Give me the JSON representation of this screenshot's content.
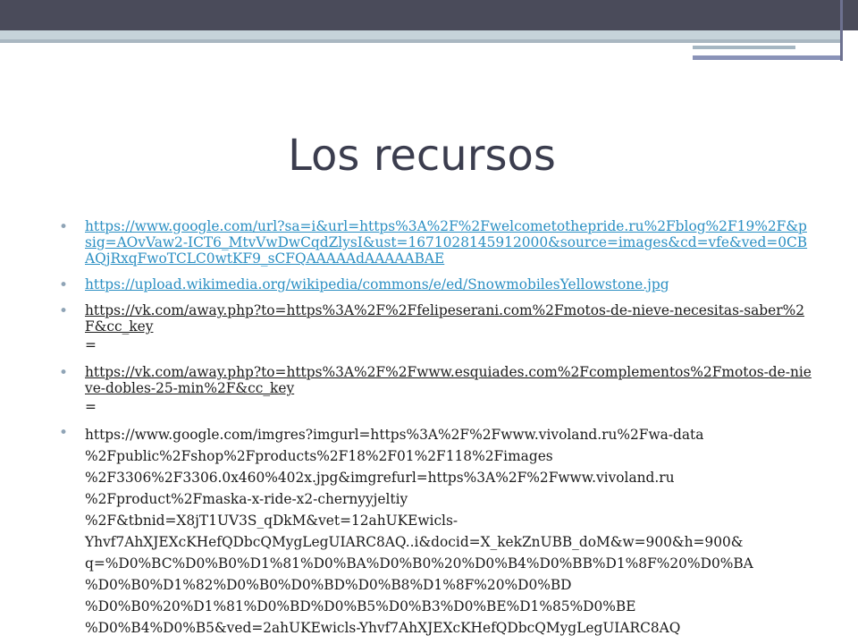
{
  "slide": {
    "title": "Los recursos",
    "bullets": [
      {
        "text": "https://www.google.com/url?sa=i&url=https%3A%2F%2Fwelcometothepride.ru%2Fblog%2F19%2F&psig=AOvVaw2-ICT6_MtvVwDwCqdZlysI&ust=1671028145912000&source=images&cd=vfe&ved=0CBAQjRxqFwoTCLC0wtKF9_sCFQAAAAAdAAAAABAE"
      },
      {
        "text": "https://upload.wikimedia.org/wikipedia/commons/e/ed/SnowmobilesYellowstone.jpg"
      },
      {
        "text": "https://vk.com/away.php?to=https%3A%2F%2Ffelipeserani.com%2Fmotos-de-nieve-necesitas-saber%2F&cc_key",
        "suffix": "="
      },
      {
        "text": "https://vk.com/away.php?to=https%3A%2F%2Fwww.esquiades.com%2Fcomplementos%2Fmotos-de-nieve-dobles-25-min%2F&cc_key",
        "suffix": "="
      },
      {
        "lines": [
          "https://www.google.com/imgres?imgurl=https%3A%2F%2Fwww.vivoland.ru%2Fwa-data",
          "%2Fpublic%2Fshop%2Fproducts%2F18%2F01%2F118%2Fimages",
          "%2F3306%2F3306.0x460%402x.jpg&imgrefurl=https%3A%2F%2Fwww.vivoland.ru",
          "%2Fproduct%2Fmaska-x-ride-x2-chernyyjeltiy",
          "%2F&tbnid=X8jT1UV3S_qDkM&vet=12ahUKEwicls-",
          "Yhvf7AhXJEXcKHefQDbcQMygLegUIARC8AQ..i&docid=X_kekZnUBB_doM&w=900&h=900&",
          "q=%D0%BC%D0%B0%D1%81%D0%BA%D0%B0%20%D0%B4%D0%BB%D1%8F%20%D0%BA",
          "%D0%B0%D1%82%D0%B0%D0%BD%D0%B8%D1%8F%20%D0%BD",
          "%D0%B0%20%D1%81%D0%BD%D0%B5%D0%B3%D0%BE%D1%85%D0%BE",
          "%D0%B4%D0%B5&ved=2ahUKEwicls-Yhvf7AhXJEXcKHefQDbcQMygLegUIARC8AQ"
        ]
      }
    ]
  },
  "colors": {
    "title": "#3b3d4e",
    "link": "#2b8fc3",
    "text": "#1b1b1b",
    "bullet": "#8fa4b6",
    "header_bar": "#4a4b5a"
  }
}
